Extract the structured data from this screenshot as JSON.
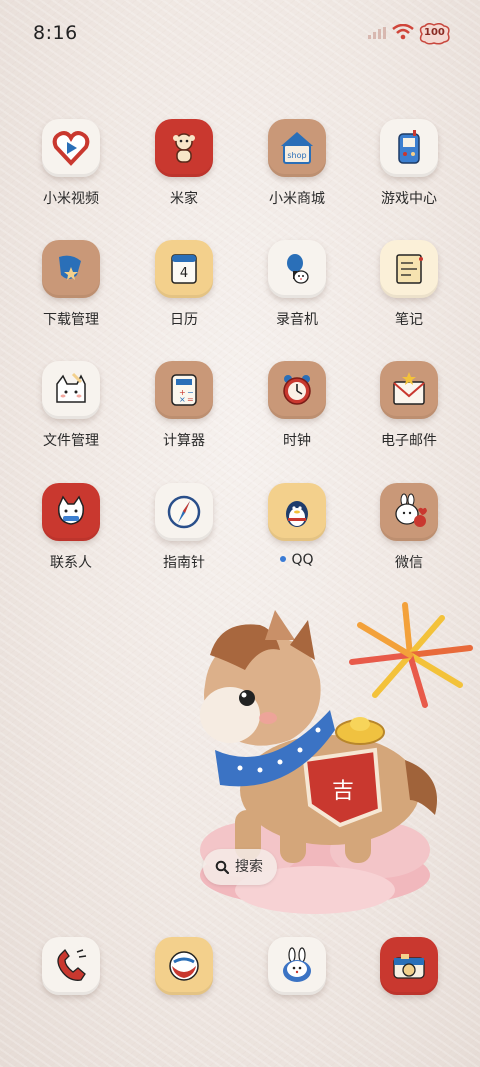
{
  "status": {
    "time": "8:16",
    "battery": "100"
  },
  "apps": [
    {
      "label": "小米视频",
      "icon": "play-heart-icon"
    },
    {
      "label": "米家",
      "icon": "flower-bear-icon"
    },
    {
      "label": "小米商城",
      "icon": "shop-house-icon"
    },
    {
      "label": "游戏中心",
      "icon": "handheld-console-icon"
    },
    {
      "label": "下载管理",
      "icon": "download-star-icon"
    },
    {
      "label": "日历",
      "icon": "calendar-icon",
      "day": "4"
    },
    {
      "label": "录音机",
      "icon": "microphone-bunny-icon"
    },
    {
      "label": "笔记",
      "icon": "notepad-icon"
    },
    {
      "label": "文件管理",
      "icon": "cat-folder-icon"
    },
    {
      "label": "计算器",
      "icon": "calculator-icon"
    },
    {
      "label": "时钟",
      "icon": "alarm-clock-icon"
    },
    {
      "label": "电子邮件",
      "icon": "envelope-star-icon"
    },
    {
      "label": "联系人",
      "icon": "cat-contact-icon"
    },
    {
      "label": "指南针",
      "icon": "compass-icon"
    },
    {
      "label": "QQ",
      "icon": "penguin-icon",
      "notification_dot": true
    },
    {
      "label": "微信",
      "icon": "bunny-chat-icon"
    }
  ],
  "dock": [
    {
      "icon": "phone-icon"
    },
    {
      "icon": "message-bubble-icon"
    },
    {
      "icon": "bunny-browser-icon"
    },
    {
      "icon": "camera-icon"
    }
  ],
  "search": {
    "label": "搜索"
  },
  "colors": {
    "red_tile": "#c9382f",
    "tan_tile": "#c99878",
    "yellow_tile": "#f3d08c",
    "accent_blue": "#3a7bd5"
  }
}
